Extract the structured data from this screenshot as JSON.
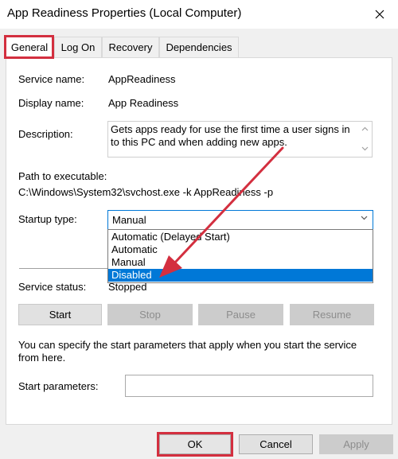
{
  "window": {
    "title": "App Readiness Properties (Local Computer)",
    "close_glyph": "✕"
  },
  "tabs": [
    {
      "label": "General"
    },
    {
      "label": "Log On"
    },
    {
      "label": "Recovery"
    },
    {
      "label": "Dependencies"
    }
  ],
  "general": {
    "service_name_label": "Service name:",
    "service_name_value": "AppReadiness",
    "display_name_label": "Display name:",
    "display_name_value": "App Readiness",
    "description_label": "Description:",
    "description_value": "Gets apps ready for use the first time a user signs in to this PC and when adding new apps.",
    "path_label": "Path to executable:",
    "path_value": "C:\\Windows\\System32\\svchost.exe -k AppReadiness -p",
    "startup_type_label": "Startup type:",
    "startup_type_value": "Manual",
    "startup_options": [
      "Automatic (Delayed Start)",
      "Automatic",
      "Manual",
      "Disabled"
    ],
    "highlighted_option": "Disabled",
    "service_status_label": "Service status:",
    "service_status_value": "Stopped",
    "buttons": {
      "start": "Start",
      "stop": "Stop",
      "pause": "Pause",
      "resume": "Resume"
    },
    "hint": "You can specify the start parameters that apply when you start the service from here.",
    "start_params_label": "Start parameters:",
    "start_params_value": ""
  },
  "footer": {
    "ok": "OK",
    "cancel": "Cancel",
    "apply": "Apply"
  },
  "colors": {
    "annotation": "#d32f3f",
    "selection": "#0078d7"
  }
}
